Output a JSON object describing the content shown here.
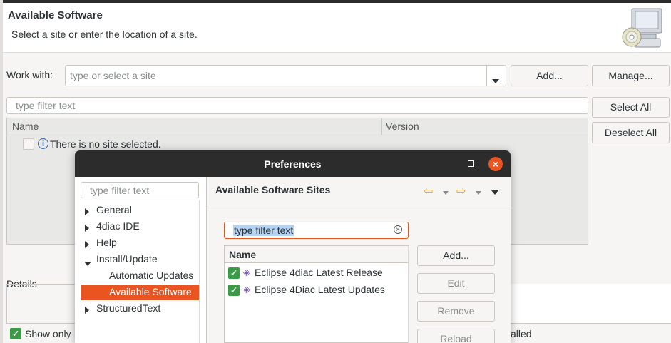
{
  "header": {
    "title": "Available Software",
    "subtitle": "Select a site or enter the location of a site."
  },
  "work_with": {
    "label": "Work with:",
    "placeholder": "type or select a site",
    "add_label": "Add...",
    "manage_label": "Manage..."
  },
  "filter": {
    "placeholder": "type filter text"
  },
  "buttons": {
    "select_all": "Select All",
    "deselect_all": "Deselect All"
  },
  "table": {
    "columns": [
      "Name",
      "Version"
    ],
    "empty_message": "There is no site selected."
  },
  "details": {
    "label": "Details",
    "show_only_label": "Show only",
    "installed_fragment": "alled"
  },
  "prefs": {
    "title": "Preferences",
    "filter_placeholder": "type filter text",
    "tree": [
      {
        "label": "General",
        "expanded": false
      },
      {
        "label": "4diac IDE",
        "expanded": false
      },
      {
        "label": "Help",
        "expanded": false
      },
      {
        "label": "Install/Update",
        "expanded": true
      },
      {
        "label": "Automatic Updates"
      },
      {
        "label": "Available Software",
        "selected": true
      },
      {
        "label": "StructuredText",
        "expanded": false
      }
    ],
    "page_title": "Available Software Sites",
    "sites_filter_value": "type filter text",
    "sites_column": "Name",
    "sites": [
      {
        "name": "Eclipse 4diac Latest Release",
        "enabled": true
      },
      {
        "name": "Eclipse 4Diac Latest Updates",
        "enabled": true
      }
    ],
    "buttons": {
      "add": "Add...",
      "edit": "Edit",
      "remove": "Remove",
      "reload": "Reload"
    }
  },
  "colors": {
    "accent": "#e95420",
    "titlebar": "#2c2c2c",
    "selection": "#e95420",
    "check": "#3a9a46"
  },
  "icons": [
    "computer-cd-icon",
    "dropdown-arrow-icon",
    "info-icon",
    "maximize-icon",
    "close-icon",
    "back-arrow-icon",
    "forward-arrow-icon",
    "menu-arrow-icon",
    "clear-icon",
    "checkbox-icon",
    "update-site-icon"
  ]
}
